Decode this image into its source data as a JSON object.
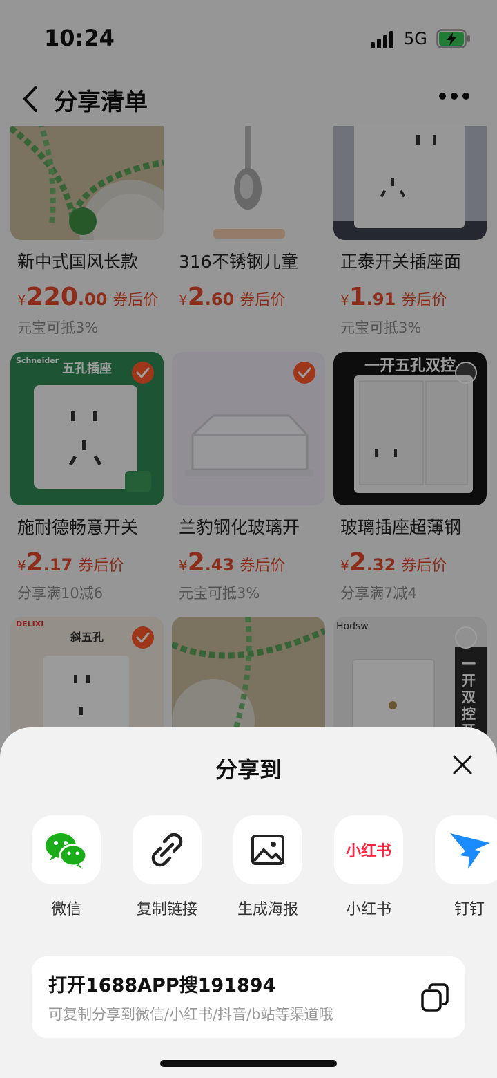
{
  "status_bar": {
    "time": "10:24",
    "network": "5G",
    "icons": [
      "signal-icon",
      "battery-charging-icon"
    ]
  },
  "nav": {
    "title": "分享清单",
    "icons": [
      "back-arrow-icon",
      "more-dots-icon"
    ]
  },
  "products": [
    {
      "name": "新中式国风长款",
      "price_int": "220",
      "price_dec": ".00",
      "currency": "¥",
      "price_note": "券后价",
      "sub": "元宝可抵3%",
      "selected": null,
      "image": "jade-bead-necklace"
    },
    {
      "name": "316不锈钢儿童",
      "price_int": "2",
      "price_dec": ".60",
      "currency": "¥",
      "price_note": "券后价",
      "sub": "",
      "selected": null,
      "image": "steel-spoon"
    },
    {
      "name": "正泰开关插座面",
      "price_int": "1",
      "price_dec": ".91",
      "currency": "¥",
      "price_note": "券后价",
      "sub": "元宝可抵3%",
      "selected": null,
      "image": "wall-socket"
    },
    {
      "name": "施耐德畅意开关",
      "price_int": "2",
      "price_dec": ".17",
      "currency": "¥",
      "price_note": "券后价",
      "sub": "分享满10减6",
      "selected": true,
      "image": "five-hole-socket",
      "image_text": "五孔插座",
      "brand_text": "Schneider"
    },
    {
      "name": "兰豹钢化玻璃开",
      "price_int": "2",
      "price_dec": ".43",
      "currency": "¥",
      "price_note": "券后价",
      "sub": "元宝可抵3%",
      "selected": true,
      "image": "clear-socket-cover"
    },
    {
      "name": "玻璃插座超薄钢",
      "price_int": "2",
      "price_dec": ".32",
      "currency": "¥",
      "price_note": "券后价",
      "sub": "分享满7减4",
      "selected": false,
      "image": "dual-switch-socket",
      "image_text": "一开五孔双控"
    },
    {
      "name": "",
      "selected": true,
      "image": "diagonal-five-hole-socket",
      "image_text": "斜五孔",
      "brand_text": "DELIXI"
    },
    {
      "name": "",
      "selected": null,
      "image": "jade-bead-necklace"
    },
    {
      "name": "",
      "selected": false,
      "image": "single-switch",
      "image_text": "一开双控开",
      "brand_text": "Hodsw"
    }
  ],
  "share_sheet": {
    "title": "分享到",
    "close_icon": "close-icon",
    "targets": [
      {
        "label": "微信",
        "icon": "wechat-icon",
        "color": "#1aad19"
      },
      {
        "label": "复制链接",
        "icon": "link-icon",
        "color": "#222222"
      },
      {
        "label": "生成海报",
        "icon": "image-icon",
        "color": "#222222"
      },
      {
        "label": "小红书",
        "icon": "xiaohongshu-icon",
        "color": "#ff2442",
        "icon_text": "小红书"
      },
      {
        "label": "钉钉",
        "icon": "dingtalk-icon",
        "color": "#1a8cff"
      }
    ],
    "copy": {
      "main": "打开1688APP搜191894",
      "sub": "可复制分享到微信/小红书/抖音/b站等渠道哦",
      "icon": "copy-icon"
    }
  }
}
